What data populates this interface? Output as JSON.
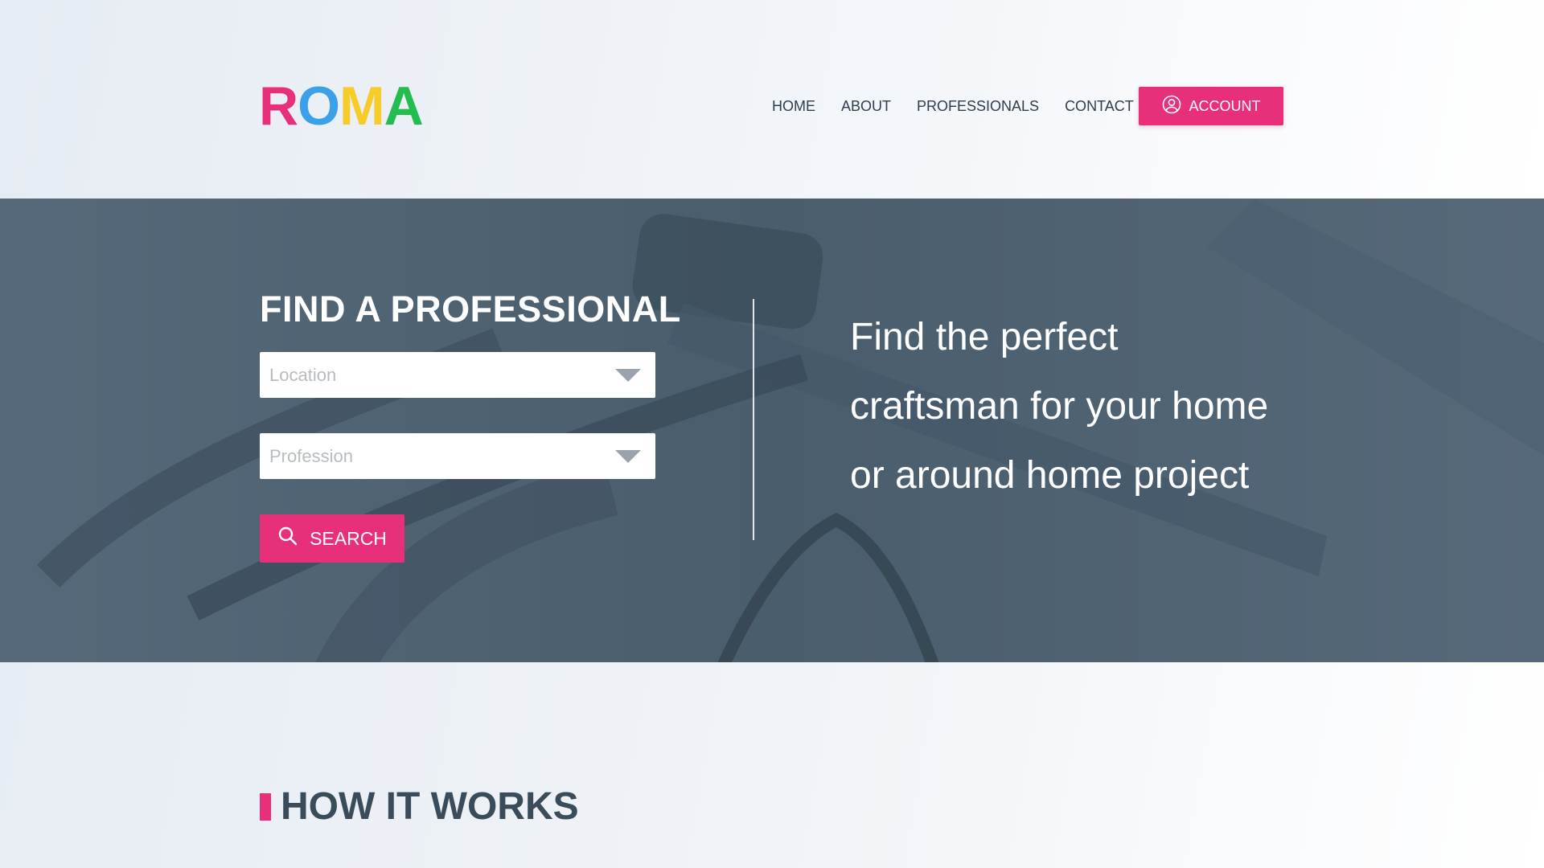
{
  "brand": {
    "letters": [
      "R",
      "O",
      "M",
      "A"
    ],
    "colors": [
      "#e8307a",
      "#3aa0e8",
      "#f6cc2a",
      "#22bd4e"
    ]
  },
  "nav": {
    "items": [
      "HOME",
      "ABOUT",
      "PROFESSIONALS",
      "CONTACT"
    ],
    "account_label": "ACCOUNT",
    "account_icon": "user-circle-icon"
  },
  "hero": {
    "title": "FIND A PROFESSIONAL",
    "location_placeholder": "Location",
    "profession_placeholder": "Profession",
    "search_label": "SEARCH",
    "search_icon": "search-icon",
    "tagline_lines": [
      "Find the perfect",
      "craftsman for your home",
      "or around home project"
    ]
  },
  "how": {
    "title": "HOW IT WORKS"
  },
  "colors": {
    "accent": "#e8307a",
    "hero_overlay": "#4e6170",
    "text_dark": "#2f3e4d"
  }
}
